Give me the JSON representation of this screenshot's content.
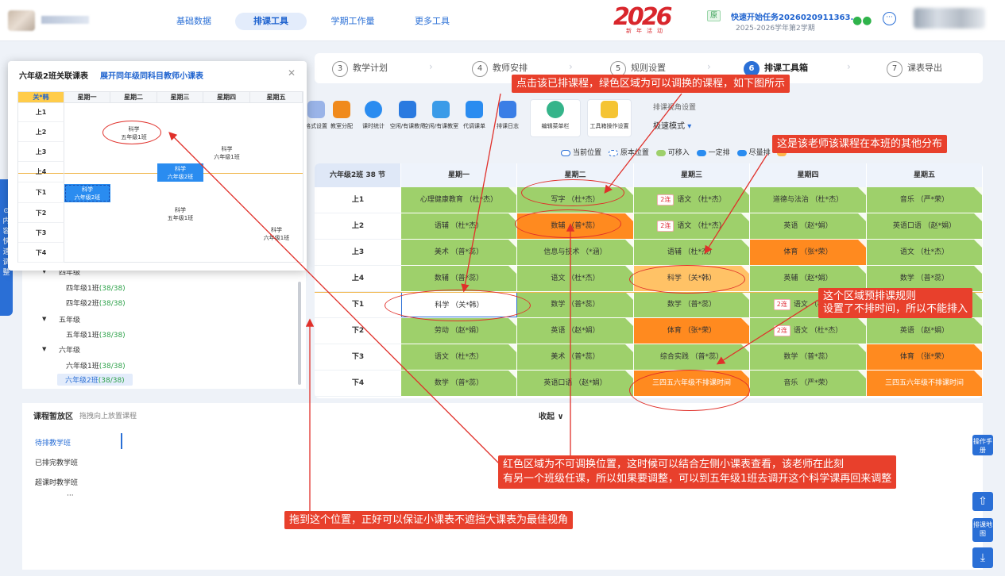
{
  "nav": {
    "items": [
      "基础数据",
      "排课工具",
      "学期工作量",
      "更多工具"
    ],
    "active": 1
  },
  "badge": {
    "big": "2026",
    "small": "新年活动"
  },
  "task": {
    "tag": "原",
    "title": "快速开始任务2026020911363...",
    "sub": "2025-2026学年第2学期"
  },
  "steps": [
    {
      "num": "3",
      "label": "教学计划"
    },
    {
      "num": "4",
      "label": "教师安排"
    },
    {
      "num": "5",
      "label": "规则设置"
    },
    {
      "num": "6",
      "label": "排课工具箱"
    },
    {
      "num": "7",
      "label": "课表导出"
    }
  ],
  "tools": [
    "格式设置",
    "教室分配",
    "课时统计",
    "空闲/有课教师",
    "空闲/有课教室",
    "代调课单",
    "排课日志",
    "编辑菜单栏",
    "工具箱操作设置"
  ],
  "view": {
    "title": "排课视角设置",
    "mode": "极速模式"
  },
  "legend": [
    {
      "label": "当前位置",
      "color": "#2a6fd6"
    },
    {
      "label": "原本位置",
      "color": "#2a6fd6"
    },
    {
      "label": "可移入",
      "color": "#9ed06b"
    },
    {
      "label": "一定排",
      "color": "#2a8cf0"
    },
    {
      "label": "尽量排",
      "color": "#2a8cf0"
    }
  ],
  "main": {
    "corner": "六年级2班 38 节",
    "days": [
      "星期一",
      "星期二",
      "星期三",
      "星期四",
      "星期五"
    ],
    "periods": [
      "上1",
      "上2",
      "上3",
      "上4",
      "下1",
      "下2",
      "下3",
      "下4"
    ],
    "cells": [
      [
        {
          "t": "心理健康教育 （杜*杰）",
          "c": "green"
        },
        {
          "t": "写字 （杜*杰）",
          "c": "green"
        },
        {
          "t": "语文 （杜*杰）",
          "c": "green",
          "tag": "2连"
        },
        {
          "t": "道德与法治 （杜*杰）",
          "c": "green"
        },
        {
          "t": "音乐 （严*荣）",
          "c": "green"
        }
      ],
      [
        {
          "t": "语辅 （杜*杰）",
          "c": "green"
        },
        {
          "t": "数辅 （普*蕊）",
          "c": "orange"
        },
        {
          "t": "语文 （杜*杰）",
          "c": "green",
          "tag": "2连"
        },
        {
          "t": "英语 （赵*娟）",
          "c": "green"
        },
        {
          "t": "英语口语 （赵*娟）",
          "c": "green"
        }
      ],
      [
        {
          "t": "美术 （普*蕊）",
          "c": "green"
        },
        {
          "t": "信息与技术 （*涵）",
          "c": "green"
        },
        {
          "t": "语辅 （杜*杰）",
          "c": "green"
        },
        {
          "t": "体育 （张*荣）",
          "c": "orange"
        },
        {
          "t": "语文 （杜*杰）",
          "c": "green"
        }
      ],
      [
        {
          "t": "数辅 （普*蕊）",
          "c": "green"
        },
        {
          "t": "语文 （杜*杰）",
          "c": "green"
        },
        {
          "t": "科学 （关*韩）",
          "c": "lightorange"
        },
        {
          "t": "英辅 （赵*娟）",
          "c": "green"
        },
        {
          "t": "数学 （普*蕊）",
          "c": "green"
        }
      ],
      [
        {
          "t": "科学 （关*韩）",
          "c": "white"
        },
        {
          "t": "数学 （普*蕊）",
          "c": "green"
        },
        {
          "t": "数学 （普*蕊）",
          "c": "green"
        },
        {
          "t": "语文 （杜*杰）",
          "c": "green",
          "tag": "2连"
        },
        {
          "t": "",
          "c": "green"
        }
      ],
      [
        {
          "t": "劳动 （赵*娟）",
          "c": "green"
        },
        {
          "t": "英语 （赵*娟）",
          "c": "green"
        },
        {
          "t": "体育 （张*荣）",
          "c": "orange"
        },
        {
          "t": "语文 （杜*杰）",
          "c": "green",
          "tag": "2连"
        },
        {
          "t": "英语 （赵*娟）",
          "c": "green"
        }
      ],
      [
        {
          "t": "语文 （杜*杰）",
          "c": "green"
        },
        {
          "t": "美术 （普*蕊）",
          "c": "green"
        },
        {
          "t": "综合实践 （普*蕊）",
          "c": "green"
        },
        {
          "t": "数学 （普*蕊）",
          "c": "green"
        },
        {
          "t": "体育 （张*荣）",
          "c": "orange"
        }
      ],
      [
        {
          "t": "数学 （普*蕊）",
          "c": "green"
        },
        {
          "t": "英语口语 （赵*娟）",
          "c": "green"
        },
        {
          "t": "三四五六年级不排课时间",
          "c": "orange"
        },
        {
          "t": "音乐 （严*荣）",
          "c": "green"
        },
        {
          "t": "三四五六年级不排课时间",
          "c": "orange"
        }
      ]
    ]
  },
  "tree": {
    "g4": "四年级",
    "c41": "四年级1班",
    "c41n": "(38/38)",
    "c42": "四年级2班",
    "c42n": "(38/38)",
    "g5": "五年级",
    "c51": "五年级1班",
    "c51n": "(38/38)",
    "g6": "六年级",
    "c61": "六年级1班",
    "c61n": "(38/38)",
    "c62": "六年级2班",
    "c62n": "(38/38)"
  },
  "bottom": {
    "title": "课程暂放区",
    "hint": "拖拽向上放置课程",
    "collapse": "收起 ∨",
    "tabs": [
      "待排教学班",
      "已排完教学班",
      "超课时教学班",
      "···"
    ]
  },
  "float_tab": "内容快速调整",
  "right_btns": {
    "manual": "操作手册",
    "map": "排课地图"
  },
  "popup": {
    "title": "六年级2班关联课表",
    "link": "展开同年级同科目教师小课表",
    "corner": "关*韩",
    "days": [
      "星期一",
      "星期二",
      "星期三",
      "星期四",
      "星期五"
    ],
    "periods": [
      "上1",
      "上2",
      "上3",
      "上4",
      "下1",
      "下2",
      "下3",
      "下4"
    ],
    "c_u2": "科学\n五年级1班",
    "c_u3": "科学\n六年级1班",
    "c_u4": "科学\n六年级2班",
    "c_d1": "科学\n六年级2班",
    "c_d2": "科学\n五年级1班",
    "c_d3": "科学\n六年级1班"
  },
  "notes": {
    "n1": "点击该已排课程，绿色区域为可以调换的课程，如下图所示",
    "n2": "这是该老师该课程在本班的其他分布",
    "n3a": "这个区域预排课规则",
    "n3b": "设置了不排时间，所以不能排入",
    "n4a": "红色区域为不可调换位置，这时候可以结合左侧小课表查看，该老师在此刻",
    "n4b": "有另一个班级任课，所以如果要调整，可以到五年级1班去调开这个科学课再回来调整",
    "n5": "拖到这个位置，正好可以保证小课表不遮挡大课表为最佳视角"
  }
}
